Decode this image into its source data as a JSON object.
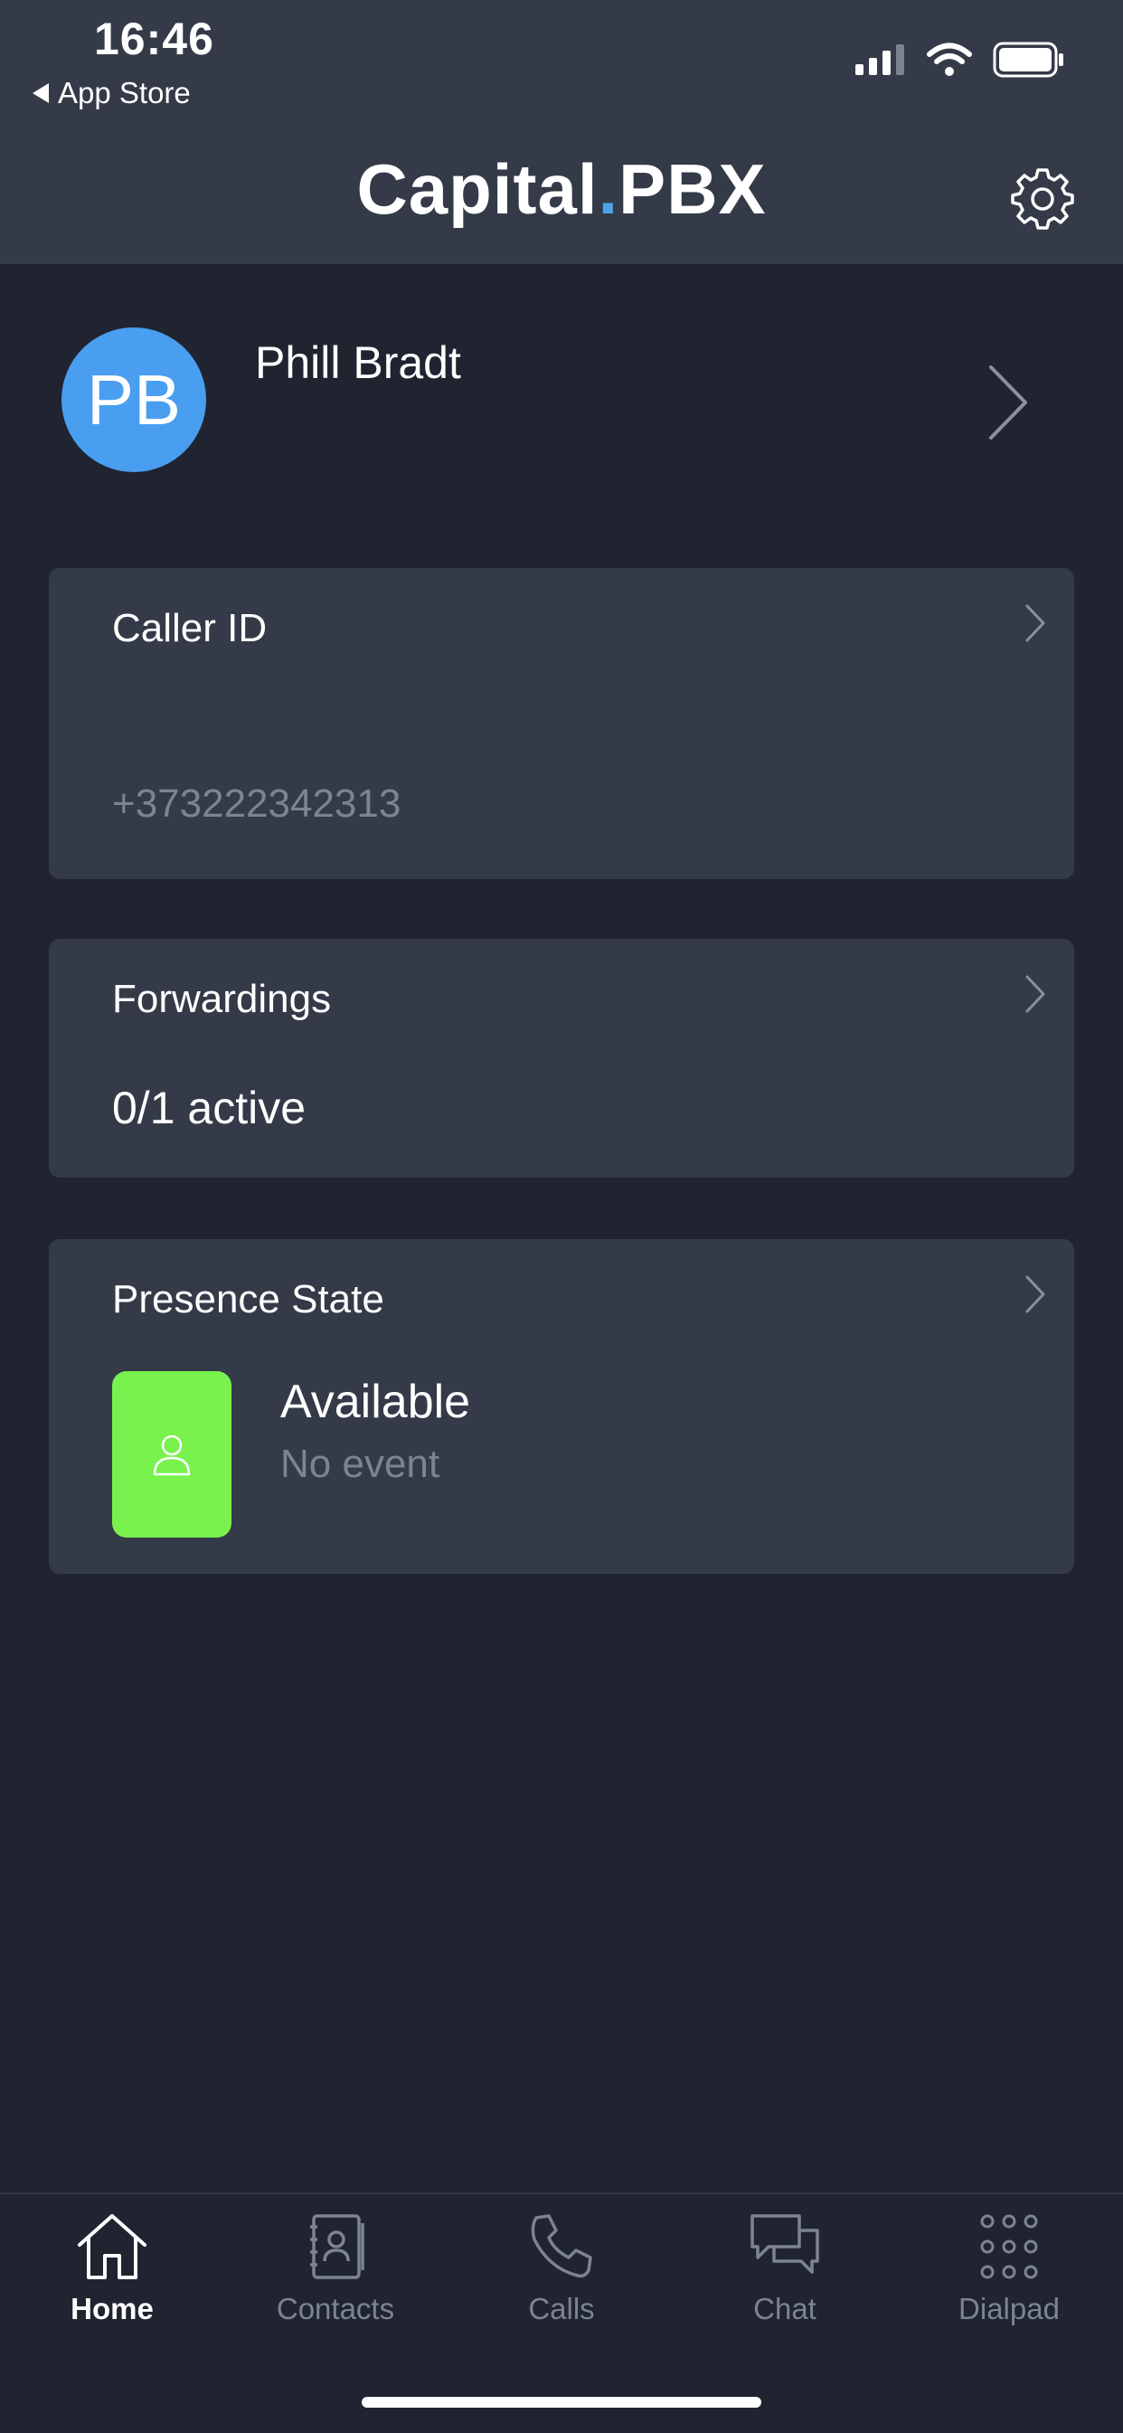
{
  "status_bar": {
    "time": "16:46",
    "back_label": "App Store"
  },
  "header": {
    "logo_part1": "Capital",
    "logo_dot": ".",
    "logo_part2": "PBX",
    "settings_icon": "gear-icon"
  },
  "profile": {
    "initials": "PB",
    "name": "Phill Bradt"
  },
  "cards": {
    "caller_id": {
      "title": "Caller ID",
      "value": "+373222342313"
    },
    "forwardings": {
      "title": "Forwardings",
      "value": "0/1 active"
    },
    "presence": {
      "title": "Presence State",
      "status": "Available",
      "event": "No event",
      "badge_color": "#79f24e"
    }
  },
  "tabs": [
    {
      "label": "Home",
      "icon": "home-icon",
      "active": true
    },
    {
      "label": "Contacts",
      "icon": "contacts-icon",
      "active": false
    },
    {
      "label": "Calls",
      "icon": "phone-icon",
      "active": false
    },
    {
      "label": "Chat",
      "icon": "chat-icon",
      "active": false
    },
    {
      "label": "Dialpad",
      "icon": "dialpad-icon",
      "active": false
    }
  ],
  "colors": {
    "background": "#1f2430",
    "surface": "#343a48",
    "accent": "#4da3e6",
    "avatar": "#4a9ef0",
    "muted_text": "#7c8391"
  }
}
